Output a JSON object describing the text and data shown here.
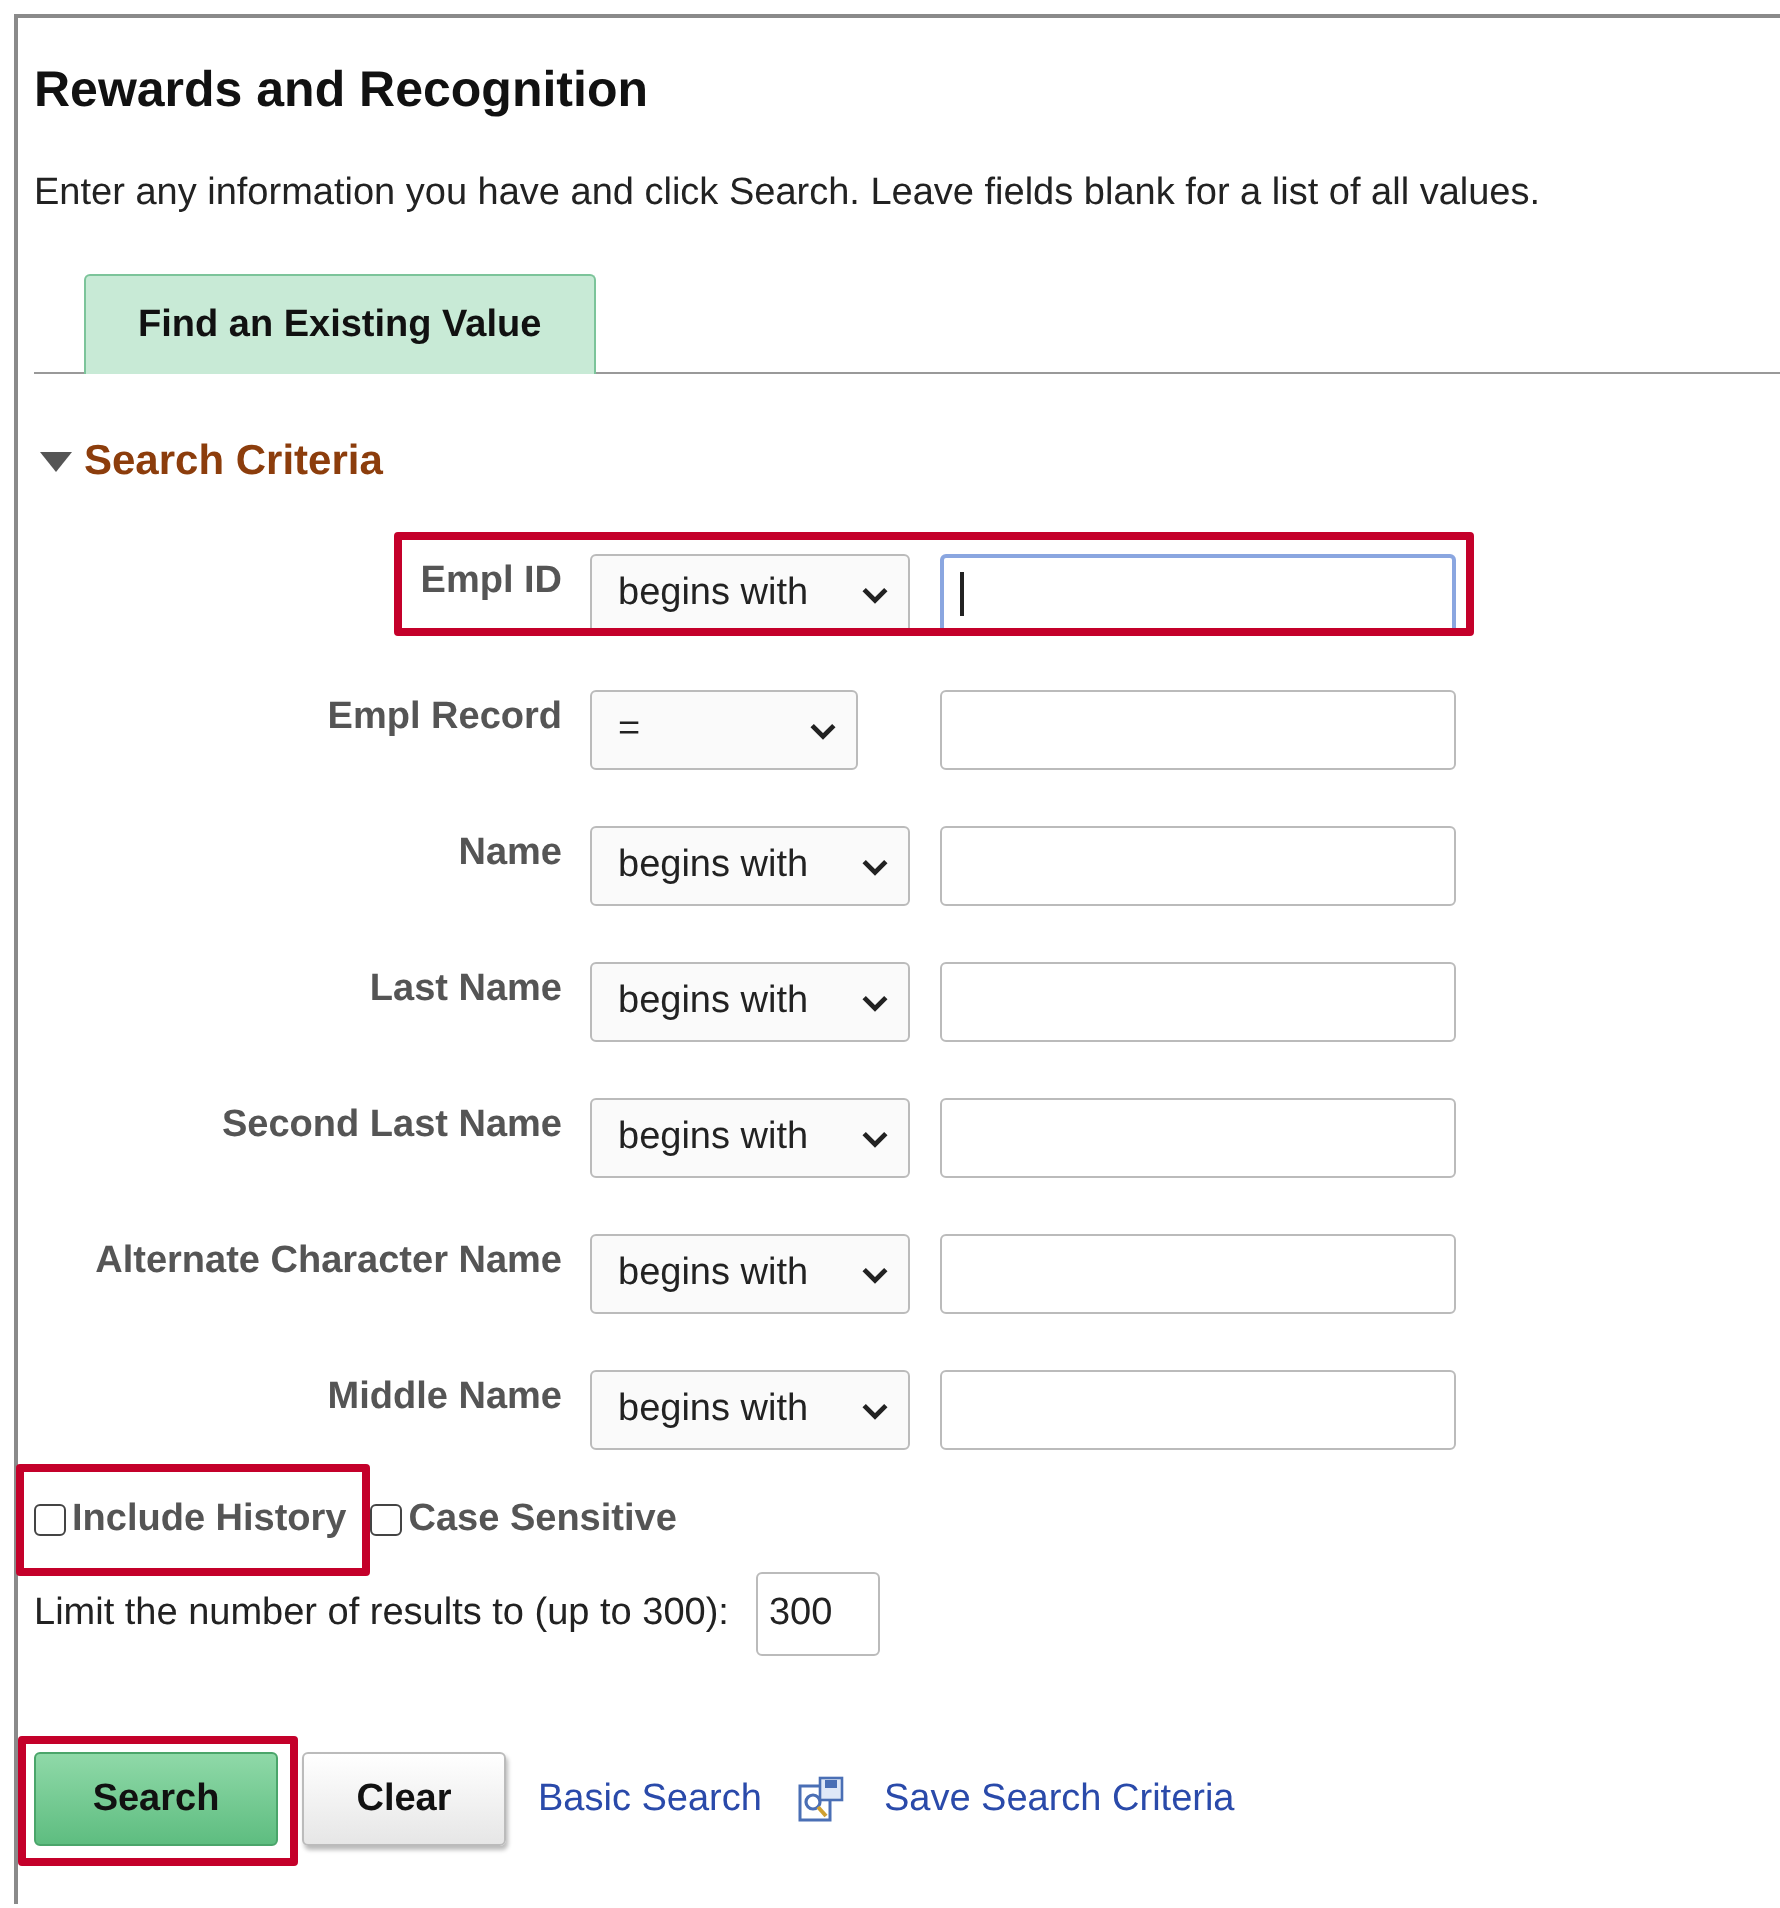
{
  "page": {
    "title": "Rewards and Recognition",
    "instructions": "Enter any information you have and click Search. Leave fields blank for a list of all values."
  },
  "tabs": [
    {
      "label": "Find an Existing Value",
      "selected": true
    }
  ],
  "section": {
    "title": "Search Criteria",
    "expanded": true
  },
  "fields": [
    {
      "label": "Empl ID",
      "operator": "begins with",
      "focused": true,
      "highlighted": true
    },
    {
      "label": "Empl Record",
      "operator": "=",
      "focused": false,
      "highlighted": false
    },
    {
      "label": "Name",
      "operator": "begins with",
      "focused": false,
      "highlighted": false
    },
    {
      "label": "Last Name",
      "operator": "begins with",
      "focused": false,
      "highlighted": false
    },
    {
      "label": "Second Last Name",
      "operator": "begins with",
      "focused": false,
      "highlighted": false
    },
    {
      "label": "Alternate Character Name",
      "operator": "begins with",
      "focused": false,
      "highlighted": false
    },
    {
      "label": "Middle Name",
      "operator": "begins with",
      "focused": false,
      "highlighted": false
    }
  ],
  "checkboxes": [
    {
      "label": "Include History",
      "checked": false,
      "highlighted": true
    },
    {
      "label": "Case Sensitive",
      "checked": false,
      "highlighted": false
    }
  ],
  "limit": {
    "label": "Limit the number of results to (up to 300):",
    "value": "300"
  },
  "buttons": [
    {
      "label": "Search",
      "kind": "primary",
      "highlighted": true
    },
    {
      "label": "Clear",
      "kind": "secondary",
      "highlighted": false
    }
  ],
  "links": [
    {
      "label": "Basic Search",
      "kind": "plain"
    },
    {
      "label": "Save Search Criteria",
      "kind": "with_icon"
    }
  ]
}
